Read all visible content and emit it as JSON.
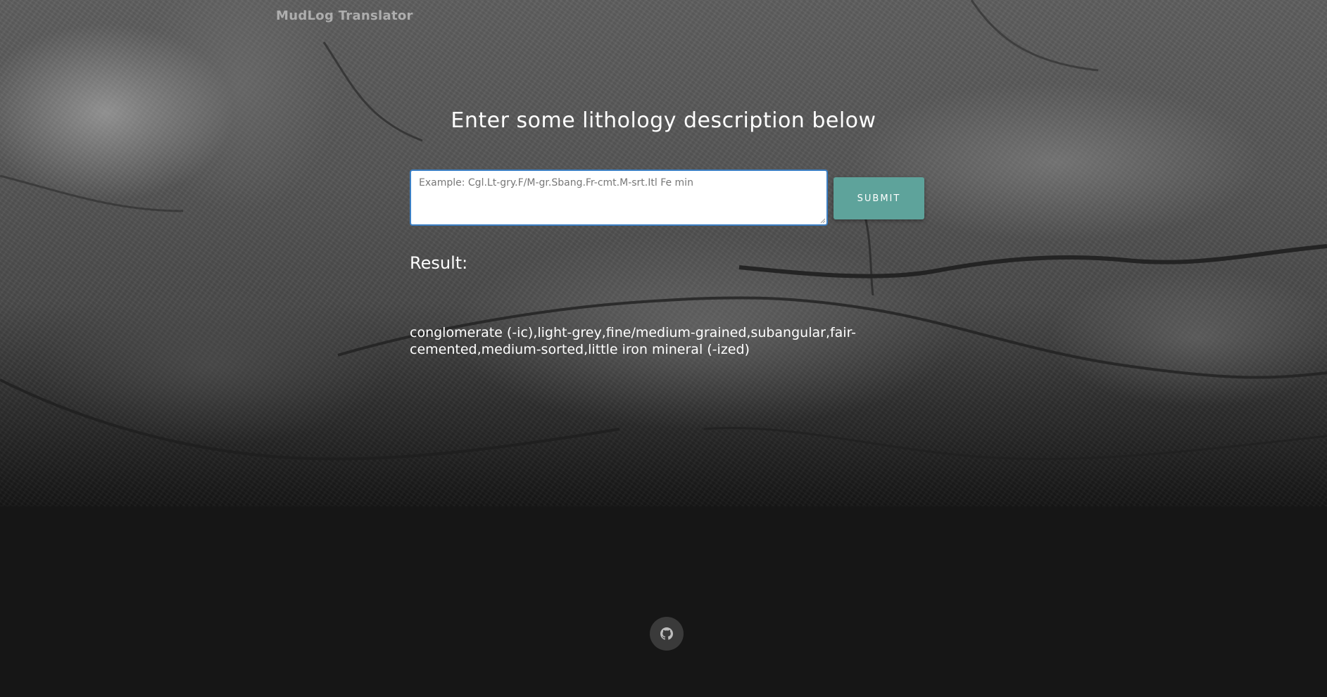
{
  "app": {
    "brand": "MudLog Translator"
  },
  "main": {
    "heading": "Enter some lithology description below",
    "input": {
      "placeholder": "Example: Cgl.Lt-gry.F/M-gr.Sbang.Fr-cmt.M-srt.Itl Fe min",
      "value": ""
    },
    "submit_label": "SUBMIT",
    "result_label": "Result:",
    "result_text": "conglomerate (-ic),light-grey,fine/medium-grained,subangular,fair-cemented,medium-sorted,little iron mineral (-ized)"
  },
  "footer": {
    "github_icon": "github-icon"
  },
  "colors": {
    "accent": "#5ea39b",
    "footer_bg": "#161616",
    "input_border": "#3b7fc4"
  }
}
